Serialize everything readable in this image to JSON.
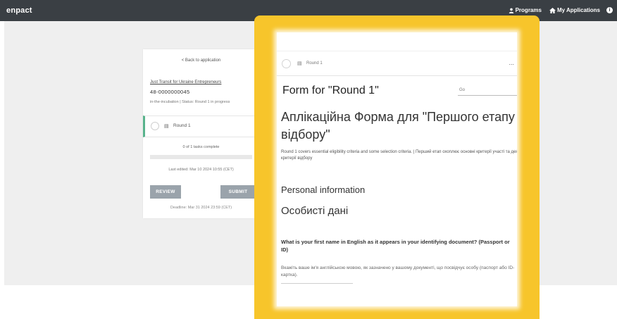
{
  "topbar": {
    "brand": "enpact",
    "nav": [
      {
        "label": "Programs",
        "icon": "user-icon"
      },
      {
        "label": "My Applications",
        "icon": "home-icon"
      }
    ],
    "info_icon": "i"
  },
  "card": {
    "back_link": "< Back to application",
    "program_name": "Just Transit for Ukraine Entrepreneurs",
    "application_id": "48-0000000045",
    "status": "in-the-incubation | Status: Round 1 in progress",
    "round_label": "Round 1",
    "tasks_text": "0 of 1 tasks complete",
    "progress_fraction": 0.0,
    "last_edited": "Last edited: Mar 10 2024 10:55 (CET)",
    "review_label": "REVIEW",
    "submit_label": "SUBMIT",
    "deadline": "Deadline: Mar 31 2024 23:59 (CET)"
  },
  "form": {
    "round_label": "Round 1",
    "more_label": "...",
    "title": "Form for \"Round 1\"",
    "go_field": "Go",
    "title_ua": "Аплікаційна Форма для \"Першого етапу відбору\"",
    "description": "Round 1 covers essential eligibility criteria and some selection criteria. | Перший етап охоплює основні критерії участі та деякі критерії відбору",
    "section_en": "Personal information",
    "section_ua": "Особисті дані",
    "question_en": "What is your first name in English as it appears in your identifying document? (Passport or ID)",
    "question_ua": "Вкажіть ваше ім'я англійською мовою, як зазначено у вашому документі, що посвідчує особу (паспорт або ID-картка)."
  },
  "colors": {
    "topbar": "#3a3f44",
    "highlight": "#f7c52b",
    "active_round": "#58b38c",
    "button": "#9aa3ab"
  }
}
